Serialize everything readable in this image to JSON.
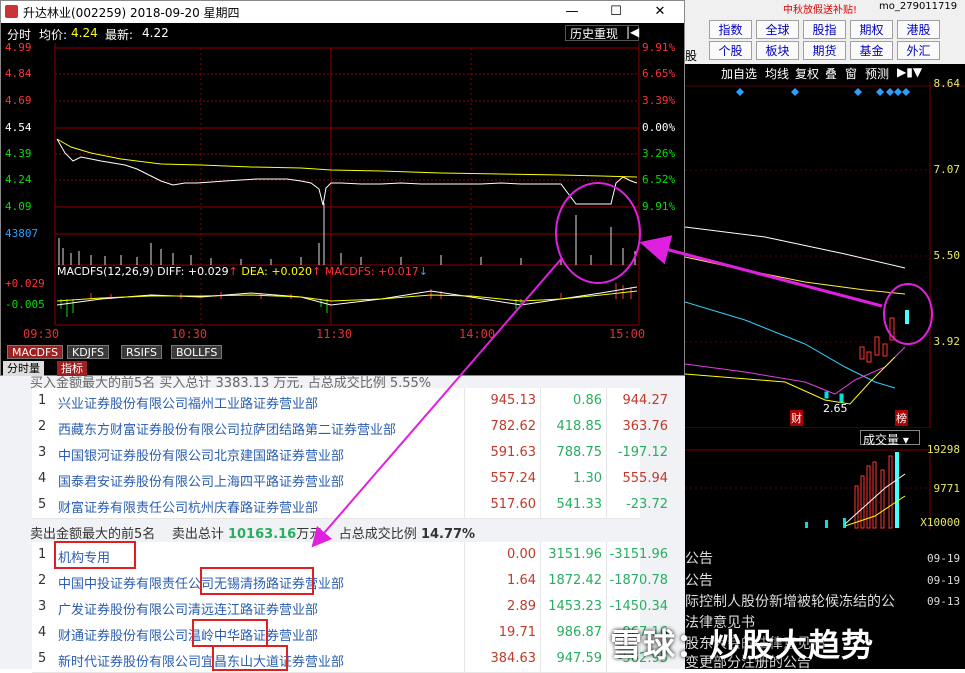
{
  "window": {
    "title": "升达林业(002259)  2018-09-20  星期四",
    "minimize": "—",
    "maximize": "☐",
    "close": "✕"
  },
  "chart_header": {
    "mode": "分时",
    "avg_label": "均价:",
    "avg_value": "4.24",
    "latest_label": "最新:",
    "latest_value": "4.22",
    "history_button": "历史重现"
  },
  "price_axis_left": [
    "4.99",
    "4.84",
    "4.69",
    "4.54",
    "4.39",
    "4.24",
    "4.09"
  ],
  "price_axis_right": [
    "9.91%",
    "6.65%",
    "3.39%",
    "0.00%",
    "3.26%",
    "6.52%",
    "9.91%"
  ],
  "volume_max": "43807",
  "macd": {
    "label": "MACDFS(12,26,9)",
    "diff_label": "DIFF:",
    "diff": "+0.029",
    "dea_label": "DEA:",
    "dea": "+0.020",
    "macdfs_label": "MACDFS:",
    "macdfs": "+0.017",
    "upper": "+0.029",
    "lower": "-0.005"
  },
  "time_axis": [
    "09:30",
    "10:30",
    "11:30",
    "14:00",
    "15:00"
  ],
  "indicator_tabs": [
    "MACDFS",
    "KDJFS",
    "RSIFS",
    "BOLLFS"
  ],
  "bottom_tabs": [
    "分时量",
    "指标"
  ],
  "colors": {
    "up_red": "#ff3232",
    "down_green": "#00e000",
    "price_line": "#ffffff",
    "avg_line": "#ffff00",
    "annotation_magenta": "#e020e0",
    "table_link": "#2a5db0"
  },
  "terminal": {
    "promo": "中秋放假送补贴!",
    "user": "mo_279011719",
    "nav_row1": [
      "指数",
      "全球",
      "股指",
      "期权",
      "港股"
    ],
    "nav_row2": [
      "个股",
      "板块",
      "期货",
      "基金",
      "外汇"
    ],
    "nav_left": "股",
    "toolbar": [
      "加自选",
      "均线",
      "复权",
      "叠",
      "窗",
      "预测"
    ],
    "price_labels": [
      "8.64",
      "7.07",
      "5.50",
      "3.92"
    ],
    "low_marker": "2.65",
    "markers": [
      "财",
      "榜"
    ],
    "volume_title": "成交量",
    "volume_labels": [
      "19298",
      "9771",
      "X10000"
    ],
    "announcements": [
      {
        "title": "公告",
        "date": "09-19"
      },
      {
        "title": "公告",
        "date": "09-19"
      },
      {
        "title": "际控制人股份新增被轮候冻结的公",
        "date": "09-13"
      },
      {
        "title": "法律意见书",
        "date": ""
      },
      {
        "title": "股东大会的法律意见书",
        "date": ""
      },
      {
        "title": "变更部分注册的公告",
        "date": ""
      }
    ]
  },
  "table": {
    "buy_head_text": "买入金额最大的前5名  买入总计 3383.13 万元, 占总成交比例 5.55%",
    "buy_rows": [
      {
        "no": "1",
        "name": "兴业证券股份有限公司福州工业路证券营业部",
        "buy": "945.13",
        "sell": "0.86",
        "net": "944.27"
      },
      {
        "no": "2",
        "name": "西藏东方财富证券股份有限公司拉萨团结路第二证券营业部",
        "buy": "782.62",
        "sell": "418.85",
        "net": "363.76"
      },
      {
        "no": "3",
        "name": "中国银河证券股份有限公司北京建国路证券营业部",
        "buy": "591.63",
        "sell": "788.75",
        "net": "-197.12"
      },
      {
        "no": "4",
        "name": "国泰君安证券股份有限公司上海四平路证券营业部",
        "buy": "557.24",
        "sell": "1.30",
        "net": "555.94"
      },
      {
        "no": "5",
        "name": "财富证券有限责任公司杭州庆春路证券营业部",
        "buy": "517.60",
        "sell": "541.33",
        "net": "-23.72"
      }
    ],
    "sell_head": {
      "a": "卖出金额最大的前5名",
      "b": "卖出总计",
      "total": "10163.16",
      "unit": "万元,",
      "c": "占总成交比例",
      "ratio": "14.77%"
    },
    "sell_rows": [
      {
        "no": "1",
        "name": "机构专用",
        "buy": "0.00",
        "sell": "3151.96",
        "net": "-3151.96"
      },
      {
        "no": "2",
        "name": "中国中投证券有限责任公司无锡清扬路证券营业部",
        "buy": "1.64",
        "sell": "1872.42",
        "net": "-1870.78"
      },
      {
        "no": "3",
        "name": "广发证券股份有限公司清远连江路证券营业部",
        "buy": "2.89",
        "sell": "1453.23",
        "net": "-1450.34"
      },
      {
        "no": "4",
        "name": "财通证券股份有限公司温岭中华路证券营业部",
        "buy": "19.71",
        "sell": "986.87",
        "net": "-967.16"
      },
      {
        "no": "5",
        "name": "新时代证券股份有限公司宜昌东山大道证券营业部",
        "buy": "384.63",
        "sell": "947.59",
        "net": "-562.95"
      }
    ]
  },
  "watermark": "雪球：炒股大趋势"
}
